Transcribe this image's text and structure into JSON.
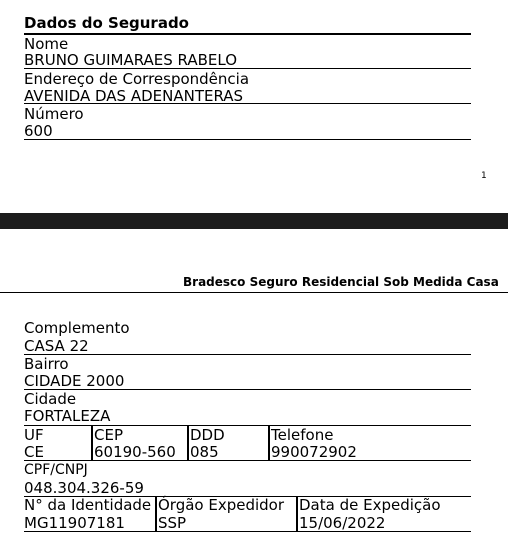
{
  "page1": {
    "section_title": "Dados do Segurado",
    "fields": [
      {
        "label": "Nome",
        "value": "BRUNO GUIMARAES RABELO"
      },
      {
        "label": "Endereço de Correspondência",
        "value": "AVENIDA DAS ADENANTERAS"
      },
      {
        "label": "Número",
        "value": "600"
      }
    ],
    "page_number": "1"
  },
  "page2": {
    "header": "Bradesco Seguro Residencial Sob Medida Casa",
    "fields": [
      {
        "label": "Complemento",
        "value": "CASA 22"
      },
      {
        "label": "Bairro",
        "value": "CIDADE 2000"
      },
      {
        "label": "Cidade",
        "value": "FORTALEZA"
      }
    ],
    "row_uf": [
      {
        "label": "UF",
        "value": "CE"
      },
      {
        "label": "CEP",
        "value": "60190-560"
      },
      {
        "label": "DDD",
        "value": "085"
      },
      {
        "label": "Telefone",
        "value": "990072902"
      }
    ],
    "cpf": {
      "label": "CPF/CNPJ",
      "value": "048.304.326-59"
    },
    "row_id": [
      {
        "label": "N° da Identidade",
        "value": "MG11907181"
      },
      {
        "label": "Órgão Expedidor",
        "value": "SSP"
      },
      {
        "label": "Data de Expedição",
        "value": "15/06/2022"
      }
    ]
  }
}
